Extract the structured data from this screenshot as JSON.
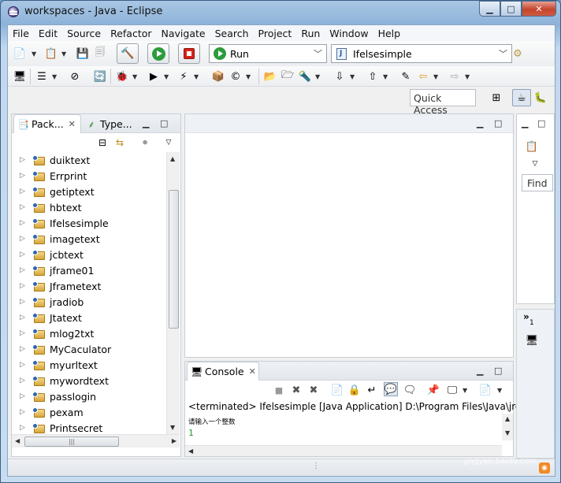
{
  "window": {
    "title": "workspaces - Java - Eclipse",
    "min": "▁",
    "max": "□",
    "close": "✕"
  },
  "menu": [
    "File",
    "Edit",
    "Source",
    "Refactor",
    "Navigate",
    "Search",
    "Project",
    "Run",
    "Window",
    "Help"
  ],
  "toolbar": {
    "run_combo": "Run",
    "config_combo": "Ifelsesimple",
    "quick_access": "Quick Access"
  },
  "package_explorer": {
    "tab_label": "Pack...",
    "other_tab_label": "Type...",
    "projects": [
      "duiktext",
      "Errprint",
      "getiptext",
      "hbtext",
      "Ifelsesimple",
      "imagetext",
      "jcbtext",
      "jframe01",
      "Jframetext",
      "jradiob",
      "Jtatext",
      "mlog2txt",
      "MyCaculator",
      "myurltext",
      "mywordtext",
      "passlogin",
      "pexam",
      "Printsecret"
    ]
  },
  "outline": {
    "find_label": "Find",
    "overflow_label": "»",
    "overflow_count": "1"
  },
  "console": {
    "tab_label": "Console",
    "terminated_line": "<terminated> Ifelsesimple [Java Application] D:\\Program Files\\Java\\jre",
    "prompt": "请输入一个整数",
    "input": "1"
  },
  "watermark": {
    "logo": "Bai度经验",
    "url": "jingyan.baidu.com"
  },
  "colors": {
    "run_green": "#2c9b3c",
    "stop_red": "#d6231b",
    "console_input": "#1a9a2a"
  }
}
